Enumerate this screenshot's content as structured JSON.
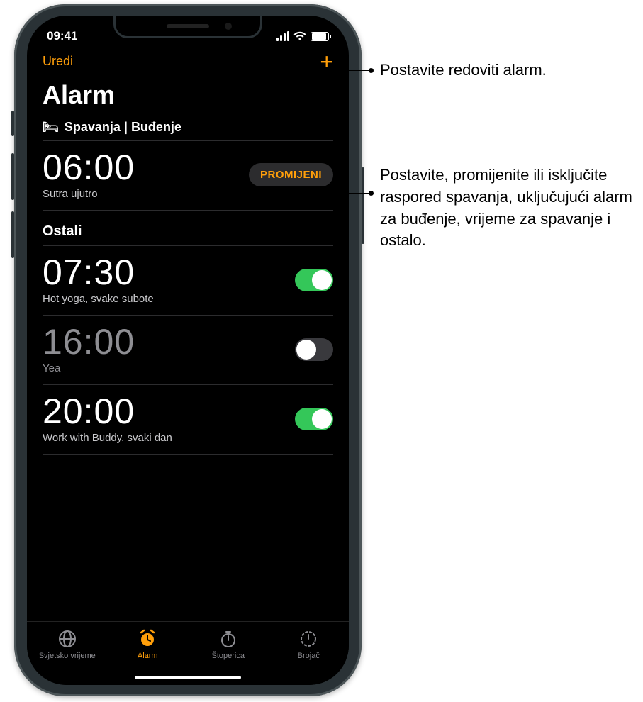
{
  "status": {
    "time": "09:41"
  },
  "nav": {
    "edit": "Uredi",
    "title": "Alarm"
  },
  "sleep_section": {
    "header": "Spavanja | Buđenje",
    "time": "06:00",
    "subtitle": "Sutra ujutro",
    "change_label": "PROMIJENI"
  },
  "others_header": "Ostali",
  "alarms": [
    {
      "time": "07:30",
      "label": "Hot yoga, svake subote",
      "on": true
    },
    {
      "time": "16:00",
      "label": "Yea",
      "on": false
    },
    {
      "time": "20:00",
      "label": "Work with Buddy, svaki dan",
      "on": true
    }
  ],
  "tabs": {
    "world": "Svjetsko vrijeme",
    "alarm": "Alarm",
    "stopwatch": "Štoperica",
    "timer": "Brojač"
  },
  "callouts": {
    "add": "Postavite redoviti alarm.",
    "change": "Postavite, promijenite ili isključite raspored spavanja, uključujući alarm za buđenje, vrijeme za spavanje i ostalo."
  }
}
